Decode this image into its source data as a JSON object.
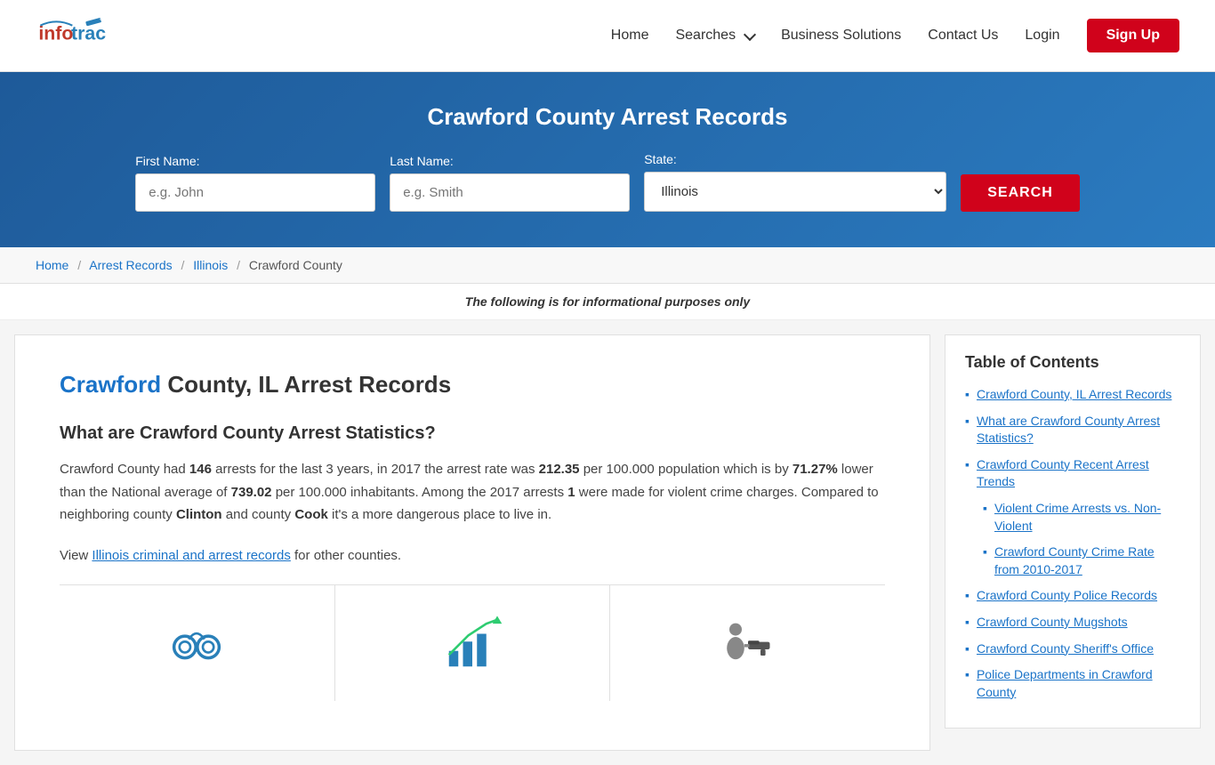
{
  "nav": {
    "logo_alt": "InfoTracer",
    "links": [
      {
        "id": "home",
        "label": "Home",
        "href": "#"
      },
      {
        "id": "searches",
        "label": "Searches",
        "href": "#",
        "has_dropdown": true
      },
      {
        "id": "business",
        "label": "Business Solutions",
        "href": "#"
      },
      {
        "id": "contact",
        "label": "Contact Us",
        "href": "#"
      },
      {
        "id": "login",
        "label": "Login",
        "href": "#"
      }
    ],
    "signup_label": "Sign Up"
  },
  "hero": {
    "title": "Crawford County Arrest Records",
    "form": {
      "first_name_label": "First Name:",
      "first_name_placeholder": "e.g. John",
      "last_name_label": "Last Name:",
      "last_name_placeholder": "e.g. Smith",
      "state_label": "State:",
      "state_default": "Illinois",
      "search_button": "SEARCH"
    }
  },
  "breadcrumb": {
    "home": "Home",
    "arrest_records": "Arrest Records",
    "illinois": "Illinois",
    "county": "Crawford County"
  },
  "info_note": "The following is for informational purposes only",
  "main": {
    "heading_highlight": "Crawford",
    "heading_rest": " County, IL Arrest Records",
    "stats_heading": "What are Crawford County Arrest Statistics?",
    "stats_text_1": "Crawford County had",
    "arrests_count": "146",
    "stats_text_2": "arrests for the last 3 years, in 2017 the arrest rate was",
    "arrest_rate": "212.35",
    "stats_text_3": "per 100.000 population which is by",
    "percent_lower": "71.27%",
    "stats_text_4": "lower than the National average of",
    "national_avg": "739.02",
    "stats_text_5": "per 100.000 inhabitants. Among the 2017 arrests",
    "violent_count": "1",
    "stats_text_6": "were made for violent crime charges. Compared to neighboring county",
    "county1": "Clinton",
    "stats_text_7": "and county",
    "county2": "Cook",
    "stats_text_8": "it's a more dangerous place to live in.",
    "view_text": "View",
    "il_link_text": "Illinois criminal and arrest records",
    "view_text_2": "for other counties."
  },
  "toc": {
    "title": "Table of Contents",
    "items": [
      {
        "id": "toc-1",
        "label": "Crawford County, IL Arrest Records",
        "sub": false
      },
      {
        "id": "toc-2",
        "label": "What are Crawford County Arrest Statistics?",
        "sub": false
      },
      {
        "id": "toc-3",
        "label": "Crawford County Recent Arrest Trends",
        "sub": false
      },
      {
        "id": "toc-4",
        "label": "Violent Crime Arrests vs. Non-Violent",
        "sub": true
      },
      {
        "id": "toc-5",
        "label": "Crawford County Crime Rate from 2010-2017",
        "sub": true
      },
      {
        "id": "toc-6",
        "label": "Crawford County Police Records",
        "sub": false
      },
      {
        "id": "toc-7",
        "label": "Crawford County Mugshots",
        "sub": false
      },
      {
        "id": "toc-8",
        "label": "Crawford County Sheriff's Office",
        "sub": false
      },
      {
        "id": "toc-9",
        "label": "Police Departments in Crawford County",
        "sub": false
      }
    ]
  }
}
